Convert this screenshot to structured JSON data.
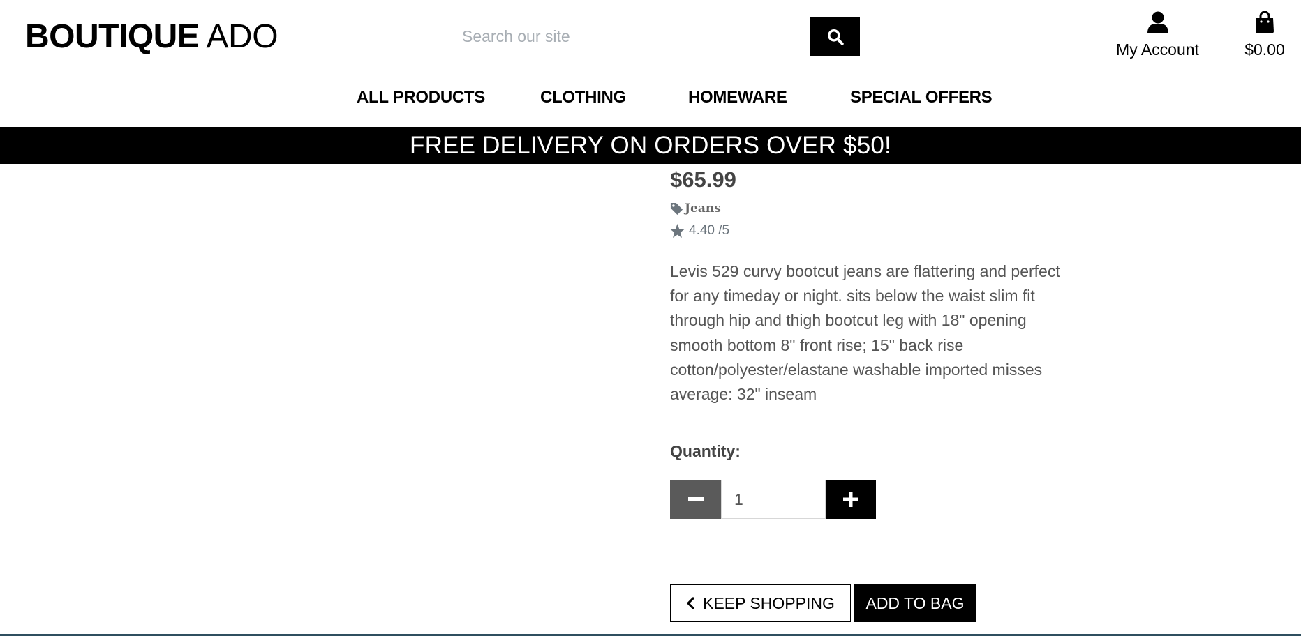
{
  "header": {
    "logo_strong": "BOUTIQUE",
    "logo_light": "ADO",
    "search_placeholder": "Search our site",
    "account_label": "My Account",
    "bag_total": "$0.00"
  },
  "nav": {
    "items": [
      "ALL PRODUCTS",
      "CLOTHING",
      "HOMEWARE",
      "SPECIAL OFFERS"
    ]
  },
  "banner": "FREE DELIVERY ON ORDERS OVER $50!",
  "product": {
    "price": "$65.99",
    "category": "Jeans",
    "rating": "4.40 /5",
    "description": "Levis 529 curvy bootcut jeans are flattering and perfect for any timeday or night. sits below the waist slim fit through hip and thigh bootcut leg with 18\" opening smooth bottom 8\" front rise; 15\" back rise cotton/polyester/elastane washable imported misses average: 32\" inseam",
    "quantity_label": "Quantity:",
    "quantity_value": "1"
  },
  "actions": {
    "keep_shopping": "KEEP SHOPPING",
    "add_to_bag": "ADD TO BAG"
  },
  "icons": {
    "search": "search-icon",
    "account": "user-icon",
    "bag": "shopping-bag-icon",
    "tag": "tag-icon",
    "star": "star-icon",
    "minus": "minus-icon",
    "plus": "plus-icon",
    "chevron": "chevron-left-icon"
  }
}
